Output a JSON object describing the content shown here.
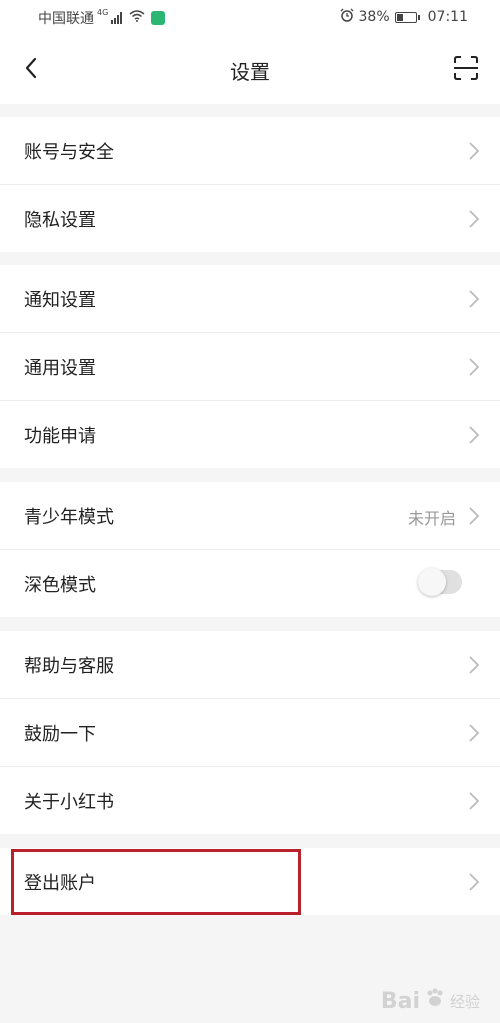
{
  "status_bar": {
    "carrier": "中国联通",
    "network": "4G",
    "battery": "38%",
    "battery_level": 0.38,
    "time": "07:11"
  },
  "nav": {
    "title": "设置",
    "back_icon": "chevron-left-icon",
    "scan_icon": "scan-icon"
  },
  "groups": [
    {
      "items": [
        {
          "label": "账号与安全"
        },
        {
          "label": "隐私设置"
        }
      ]
    },
    {
      "items": [
        {
          "label": "通知设置"
        },
        {
          "label": "通用设置"
        },
        {
          "label": "功能申请"
        }
      ]
    },
    {
      "items": [
        {
          "label": "青少年模式",
          "value": "未开启"
        },
        {
          "label": "深色模式",
          "toggle": false
        }
      ]
    },
    {
      "items": [
        {
          "label": "帮助与客服"
        },
        {
          "label": "鼓励一下"
        },
        {
          "label": "关于小红书"
        }
      ]
    },
    {
      "items": [
        {
          "label": "登出账户"
        }
      ]
    }
  ],
  "watermark": {
    "brand": "Bai",
    "sub": "经验"
  },
  "colors": {
    "highlight": "#b8202b",
    "background": "#f5f5f5"
  }
}
